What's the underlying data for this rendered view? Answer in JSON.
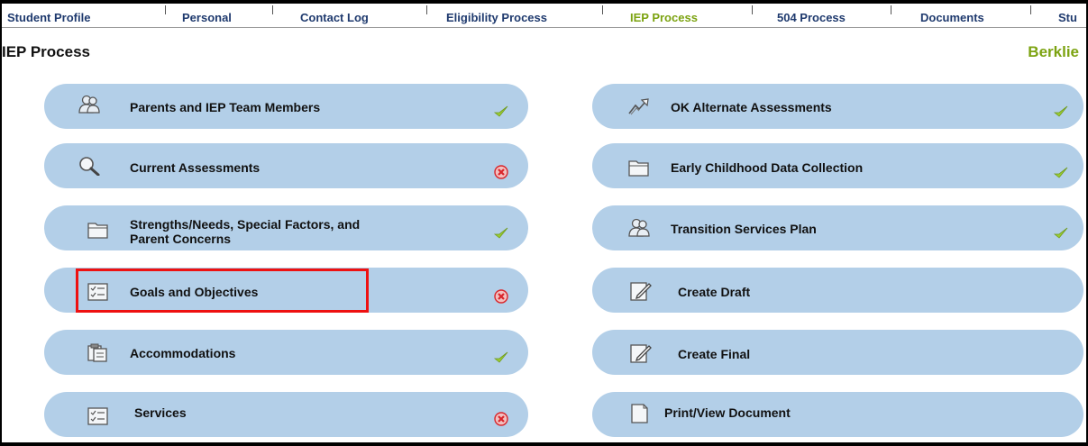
{
  "tabs": [
    {
      "label": "Student Profile",
      "active": false
    },
    {
      "label": "Personal",
      "active": false
    },
    {
      "label": "Contact Log",
      "active": false
    },
    {
      "label": "Eligibility Process",
      "active": false
    },
    {
      "label": "IEP Process",
      "active": true
    },
    {
      "label": "504 Process",
      "active": false
    },
    {
      "label": "Documents",
      "active": false
    },
    {
      "label": "Stu",
      "active": false
    }
  ],
  "header": {
    "title": "IEP Process",
    "student": "Berklie"
  },
  "colors": {
    "accent_green": "#7ca311",
    "pill_blue": "#b3cfe8",
    "complete": "#9acd32",
    "incomplete": "#d9252a",
    "highlight": "#ee1111"
  },
  "sections": {
    "left": [
      {
        "label": "Parents and IEP Team Members",
        "icon": "people-icon",
        "status": "complete"
      },
      {
        "label": "Current Assessments",
        "icon": "magnifier-icon",
        "status": "incomplete"
      },
      {
        "label": "Strengths/Needs, Special Factors, and",
        "label2": "Parent Concerns",
        "icon": "folder-icon",
        "status": "complete"
      },
      {
        "label": "Goals and Objectives",
        "icon": "checklist-icon",
        "status": "incomplete",
        "highlighted": true
      },
      {
        "label": "Accommodations",
        "icon": "clipboard-icon",
        "status": "complete"
      },
      {
        "label": "Services",
        "icon": "checklist-icon",
        "status": "incomplete"
      }
    ],
    "right": [
      {
        "label": "OK Alternate Assessments",
        "icon": "trend-arrow-icon",
        "status": "complete"
      },
      {
        "label": "Early Childhood Data Collection",
        "icon": "folder-icon",
        "status": "complete"
      },
      {
        "label": "Transition Services Plan",
        "icon": "people-icon",
        "status": "complete"
      },
      {
        "label": "Create Draft",
        "icon": "edit-document-icon",
        "status": "none"
      },
      {
        "label": "Create Final",
        "icon": "edit-document-icon",
        "status": "none"
      },
      {
        "label": "Print/View Document",
        "icon": "document-icon",
        "status": "none"
      }
    ]
  }
}
